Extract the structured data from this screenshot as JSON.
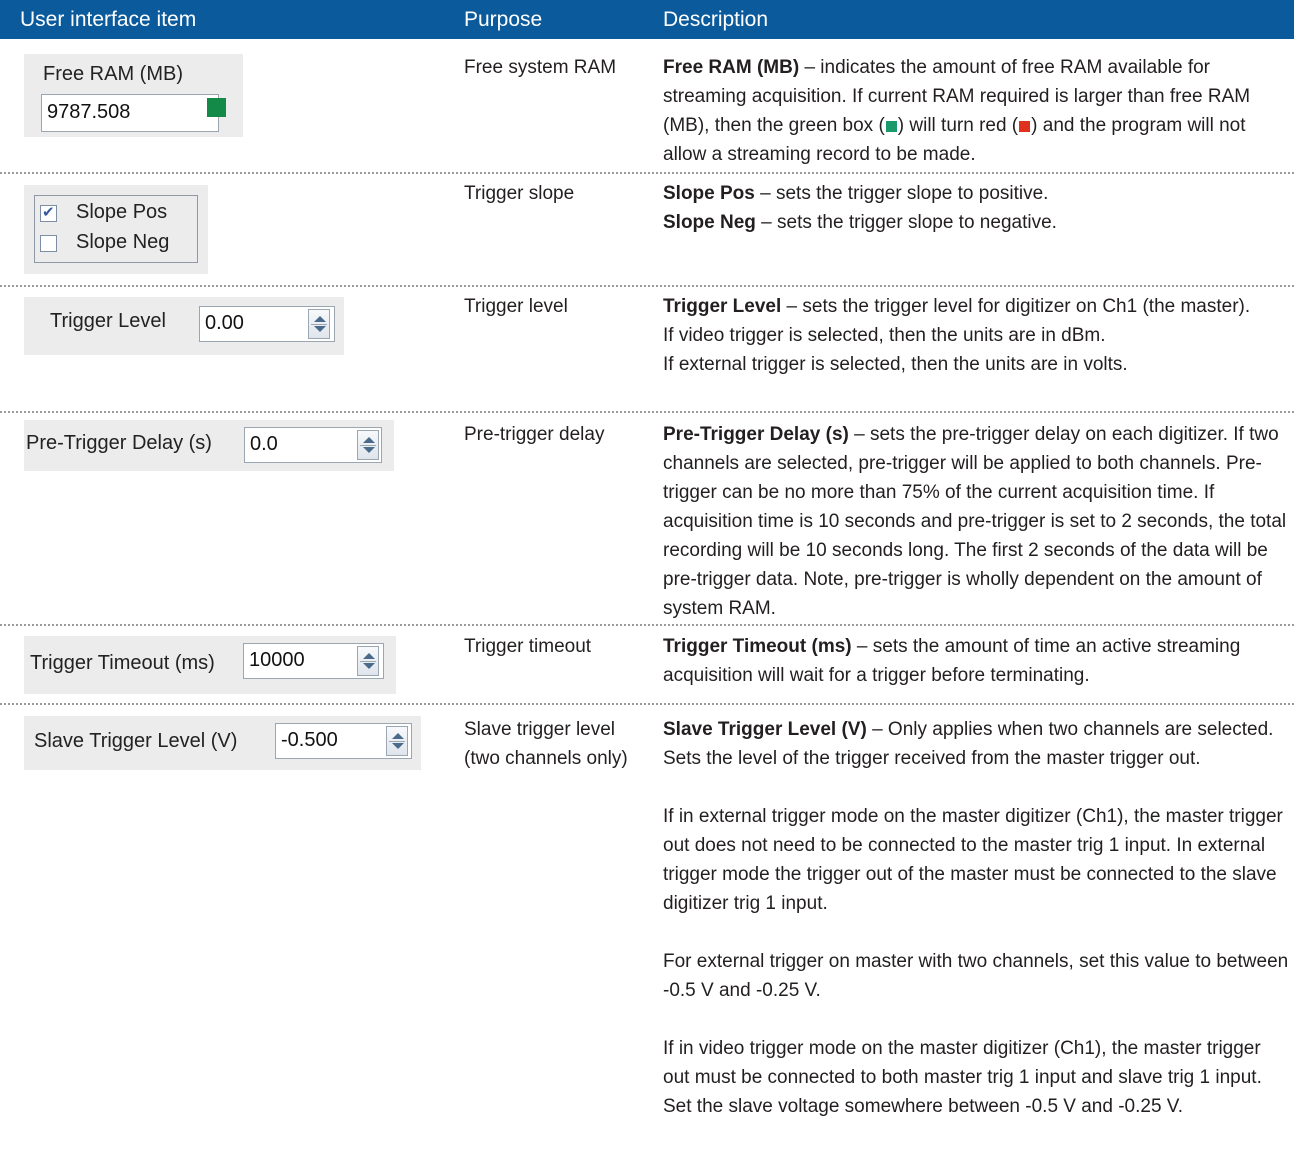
{
  "header": {
    "col_item": "User interface item",
    "col_purpose": "Purpose",
    "col_description": "Description"
  },
  "rows": [
    {
      "widget": {
        "label": "Free RAM (MB)",
        "value": "9787.508",
        "indicator_color": "#138a47"
      },
      "purpose": "Free system RAM",
      "desc": {
        "term": "Free RAM (MB)",
        "t1": " – indicates the amount of free RAM available for streaming acquisition. If current RAM required is larger than free RAM (MB), then the green box (",
        "t2": ") will turn red (",
        "t3": ") and the program will not allow a streaming record to be made."
      }
    },
    {
      "widget": {
        "opt1": "Slope Pos",
        "opt1_checked": true,
        "opt2": "Slope Neg",
        "opt2_checked": false
      },
      "purpose": "Trigger slope",
      "desc": {
        "term1": "Slope Pos",
        "text1": " – sets the trigger slope to positive.",
        "term2": "Slope Neg",
        "text2": " – sets the trigger slope to negative."
      }
    },
    {
      "widget": {
        "label": "Trigger Level",
        "value": "0.00"
      },
      "purpose": "Trigger level",
      "desc": {
        "term": "Trigger Level",
        "text": " – sets the trigger level for digitizer on Ch1 (the master).",
        "line2": "If video trigger is selected, then the units are in dBm.",
        "line3": "If external trigger is selected, then the units are in volts."
      }
    },
    {
      "widget": {
        "label": "Pre-Trigger Delay (s)",
        "value": "0.0"
      },
      "purpose": "Pre-trigger delay",
      "desc": {
        "term": "Pre-Trigger Delay (s)",
        "text": " – sets the pre-trigger delay on each digitizer. If two channels are selected, pre-trigger will be applied to both channels. Pre-trigger can be no more than 75% of the current acquisition time. If acquisition time is 10 seconds and pre-trigger is set to 2 seconds, the total recording will be 10 seconds long. The first 2 seconds of the data will be pre-trigger data. Note, pre-trigger is wholly dependent on the amount of system RAM."
      }
    },
    {
      "widget": {
        "label": "Trigger Timeout (ms)",
        "value": "10000"
      },
      "purpose": "Trigger timeout",
      "desc": {
        "term": "Trigger Timeout (ms)",
        "text": " – sets the amount of time an active streaming acquisition will wait for a trigger before terminating."
      }
    },
    {
      "widget": {
        "label": "Slave Trigger Level (V)",
        "value": "-0.500"
      },
      "purpose": "Slave trigger level (two channels only)",
      "desc": {
        "term": "Slave Trigger Level (V)",
        "text": " – Only applies when two channels are selected. Sets the level of the trigger received from the master trigger out.",
        "p2": "If in external trigger mode on the master digitizer (Ch1), the master trigger out does not need to be connected to the master trig 1 input. In external trigger mode the trigger out of the master must be connected to the slave digitizer trig 1 input.",
        "p3": "For external trigger on master with two channels, set this value to between -0.5 V and -0.25 V.",
        "p4": "If in video trigger mode on the master digitizer (Ch1), the master trigger out must be connected to both master trig 1 input and slave trig 1 input. Set the slave voltage somewhere between -0.5 V and -0.25 V."
      }
    }
  ],
  "colors": {
    "header_bg": "#0b5a9c",
    "green_box": "#1a9a6a",
    "red_box": "#e0301e"
  }
}
